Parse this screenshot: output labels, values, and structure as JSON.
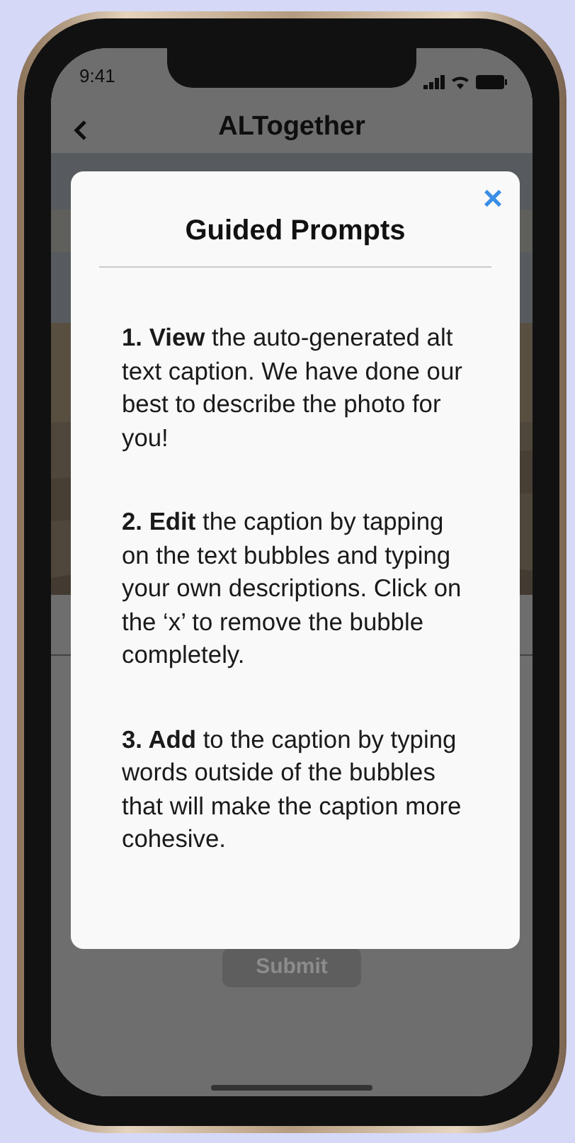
{
  "status_bar": {
    "time": "9:41"
  },
  "nav": {
    "title": "ALTogether"
  },
  "submit_button": {
    "label": "Submit"
  },
  "modal": {
    "title": "Guided Prompts",
    "close": "×",
    "steps": [
      "**1. View** the auto-generated alt text caption. We have done our best to describe the photo for you!",
      "**2. Edit** the caption by tapping on the text bubbles and typing your own descriptions. Click on the ‘x’ to remove the bubble completely.",
      "**3. Add** to the caption by typing words outside of the bubbles that will make the caption more cohesive."
    ]
  }
}
